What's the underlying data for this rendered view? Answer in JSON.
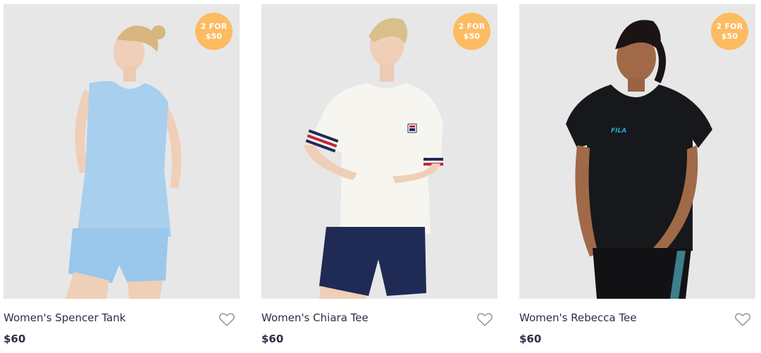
{
  "products": [
    {
      "name": "Women's Spencer Tank",
      "price": "$60",
      "badge": {
        "line1": "2 FOR",
        "line2": "$50"
      },
      "top_color": "#a9cfee",
      "bottom_color": "#9ac7ec"
    },
    {
      "name": "Women's Chiara Tee",
      "price": "$60",
      "badge": {
        "line1": "2 FOR",
        "line2": "$50"
      },
      "top_color": "#f7f5ef",
      "bottom_color": "#1f2a55"
    },
    {
      "name": "Women's Rebecca Tee",
      "price": "$60",
      "badge": {
        "line1": "2 FOR",
        "line2": "$50"
      },
      "top_color": "#17181b",
      "bottom_color": "#121214",
      "logo_text": "FILA"
    }
  ],
  "icons": {
    "wishlist": "heart-outline-icon"
  },
  "colors": {
    "badge": "#fdbb62",
    "text": "#2b2f45",
    "image_bg": "#e7e7e8"
  }
}
